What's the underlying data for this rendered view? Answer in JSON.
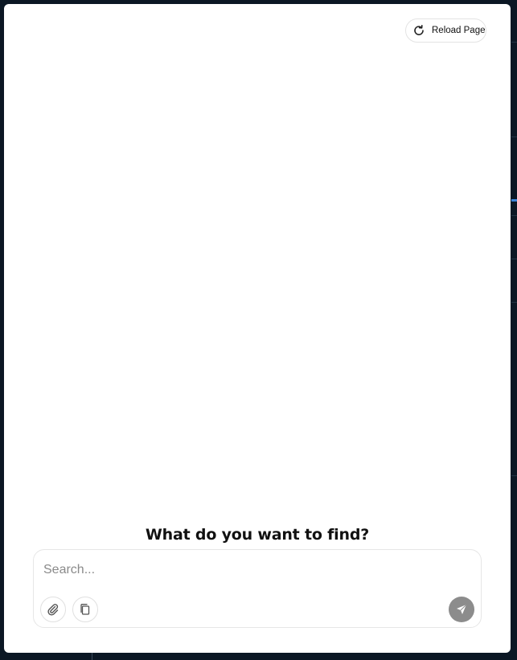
{
  "header": {
    "reload_label": "Reload Page",
    "reload_icon": "reload-icon"
  },
  "main": {
    "heading": "What do you want to find?"
  },
  "search": {
    "placeholder": "Search...",
    "value": "",
    "attach_icon": "paperclip-icon",
    "copy_icon": "copy-icon",
    "send_icon": "send-icon"
  },
  "colors": {
    "backdrop": "#0b1724",
    "modal": "#ffffff",
    "send_button": "#8c8c8c",
    "accent_blue": "#3a82d6"
  }
}
